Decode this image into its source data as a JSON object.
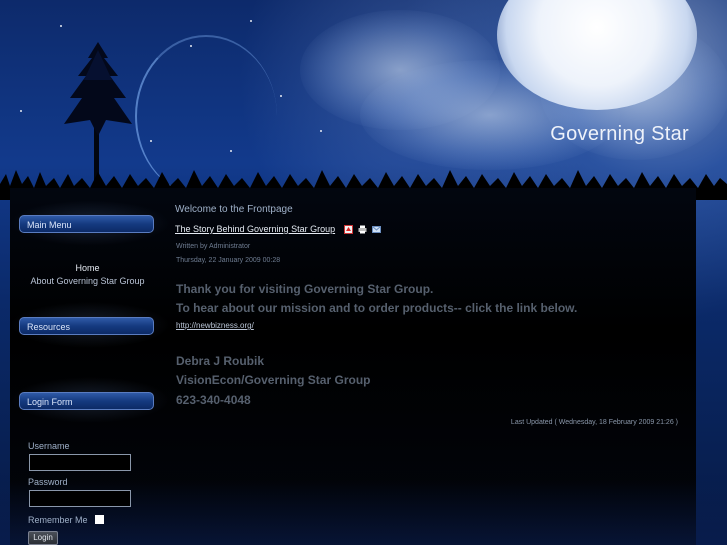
{
  "header": {
    "site_title": "Governing Star"
  },
  "sidebar": {
    "main_menu_title": "Main Menu",
    "menu_items": [
      {
        "label": "Home"
      },
      {
        "label": "About Governing Star Group"
      }
    ],
    "resources_title": "Resources",
    "login_form_title": "Login Form",
    "login": {
      "username_label": "Username",
      "username_value": "",
      "password_label": "Password",
      "password_value": "",
      "remember_label": "Remember Me",
      "login_button": "Login"
    }
  },
  "main": {
    "heading": "Welcome to the Frontpage",
    "article": {
      "title": "The Story Behind Governing Star Group",
      "icons": [
        "pdf-icon",
        "print-icon",
        "email-icon"
      ],
      "author": "Written by Administrator",
      "date": "Thursday, 22 January 2009 00:28",
      "line1": "Thank you for visiting Governing Star Group.",
      "line2": "To hear about our mission and to order products-- click the link below.",
      "url": "http://newbizness.org/",
      "signature_name": "Debra J Roubik",
      "signature_org": "VisionEcon/Governing Star Group",
      "signature_phone": "623-340-4048",
      "last_updated": "Last Updated ( Wednesday, 18 February 2009 21:26 )"
    }
  },
  "colors": {
    "sky": "#123a8c",
    "panel": "#000000",
    "module_title": "#153a80",
    "muted_text": "#56606e"
  }
}
